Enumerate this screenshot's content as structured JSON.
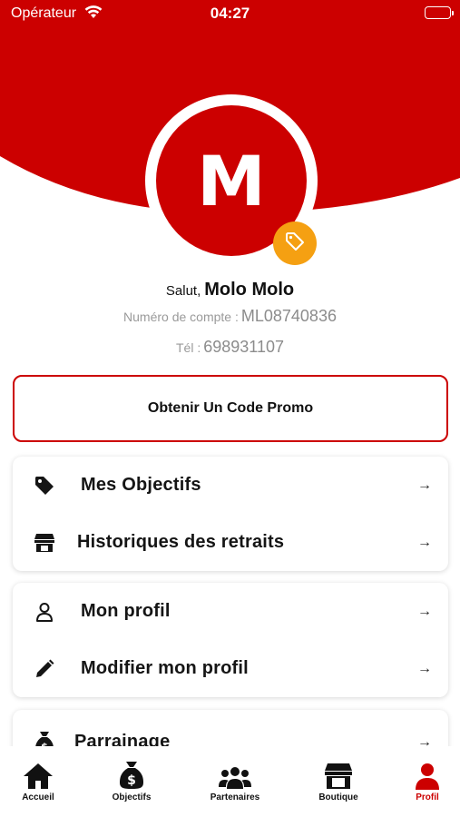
{
  "status_bar": {
    "carrier": "Opérateur",
    "time": "04:27"
  },
  "profile": {
    "initial": "M",
    "greeting_prefix": "Salut,",
    "name": "Molo Molo",
    "account_label": "Numéro de compte :",
    "account_number": "ML08740836",
    "phone_label": "Tél :",
    "phone_number": "698931107"
  },
  "promo_button_label": "Obtenir Un Code Promo",
  "menu_groups": [
    {
      "items": [
        {
          "label": "Mes Objectifs",
          "icon": "tag-icon"
        },
        {
          "label": "Historiques des retraits",
          "icon": "store-icon"
        }
      ]
    },
    {
      "items": [
        {
          "label": "Mon profil",
          "icon": "user-icon"
        },
        {
          "label": "Modifier mon profil",
          "icon": "pencil-icon"
        }
      ]
    },
    {
      "items": [
        {
          "label": "Parrainage",
          "icon": "money-bag-icon"
        }
      ]
    }
  ],
  "arrow_glyph": "→",
  "tabs": [
    {
      "label": "Accueil",
      "icon": "home-icon"
    },
    {
      "label": "Objectifs",
      "icon": "money-bag-icon"
    },
    {
      "label": "Partenaires",
      "icon": "users-icon"
    },
    {
      "label": "Boutique",
      "icon": "store-icon"
    },
    {
      "label": "Profil",
      "icon": "user-icon",
      "active": true
    }
  ],
  "colors": {
    "brand_red": "#cc0000",
    "badge_orange": "#f5a012",
    "text_dark": "#111111",
    "text_muted": "#9a9a9a"
  }
}
